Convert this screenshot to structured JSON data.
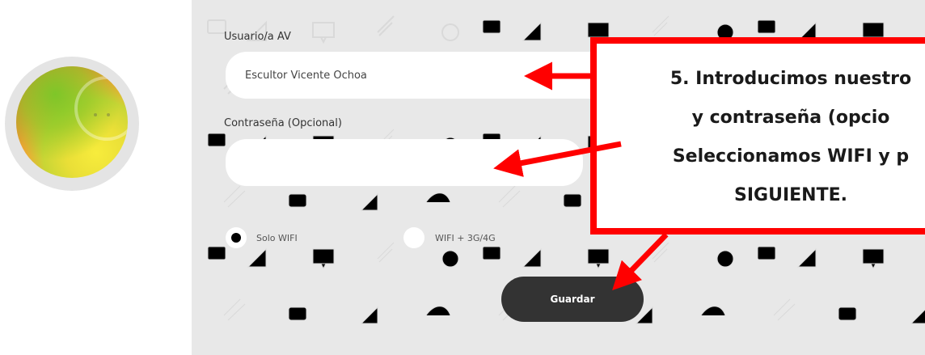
{
  "form": {
    "user_label": "Usuario/a AV",
    "user_value": "Escultor Vicente Ochoa",
    "password_label": "Contraseña (Opcional)",
    "password_value": "",
    "radio_options": [
      {
        "label": "Solo WIFI",
        "selected": true
      },
      {
        "label": "WIFI + 3G/4G",
        "selected": false
      }
    ],
    "save_label": "Guardar"
  },
  "annotation": {
    "lines": [
      "5. Introducimos nuestro",
      "y contraseña (opcio",
      "Seleccionamos WIFI y p",
      "SIGUIENTE."
    ],
    "color": "#ff0000"
  },
  "icons": {
    "logo": "smiley-ball-logo",
    "password_toggle": "eye-icon"
  }
}
